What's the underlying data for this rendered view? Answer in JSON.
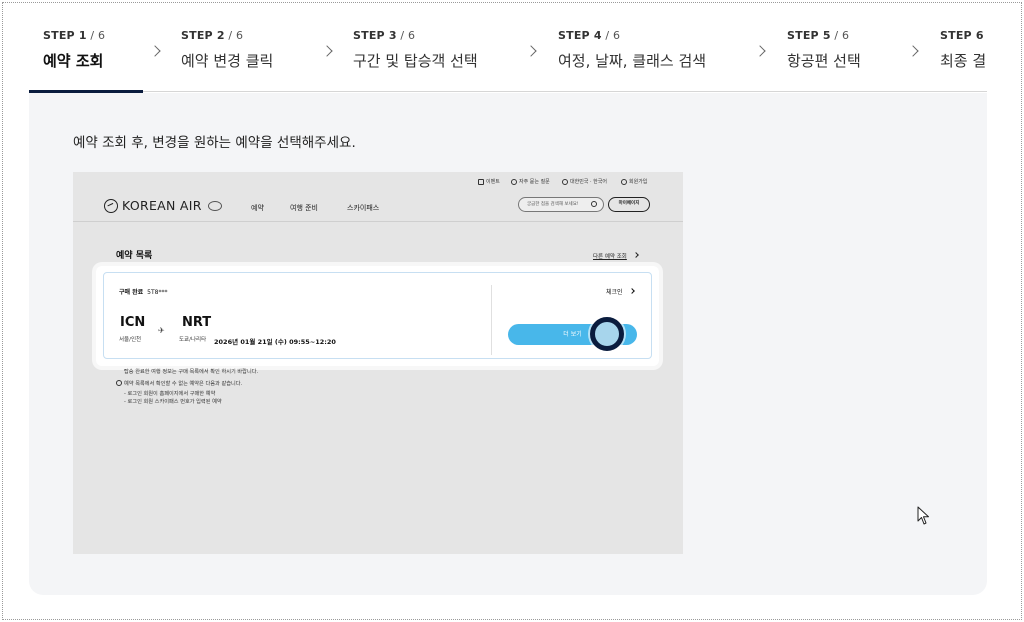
{
  "steps": [
    {
      "num": "STEP 1",
      "total": " / 6",
      "title": "예약 조회"
    },
    {
      "num": "STEP 2",
      "total": " / 6",
      "title": "예약 변경 클릭"
    },
    {
      "num": "STEP 3",
      "total": " / 6",
      "title": "구간 및 탑승객 선택"
    },
    {
      "num": "STEP 4",
      "total": " / 6",
      "title": "여정, 날짜, 클래스 검색"
    },
    {
      "num": "STEP 5",
      "total": " / 6",
      "title": "항공편 선택"
    },
    {
      "num": "STEP 6",
      "total": " / 6",
      "title": "최종 결"
    }
  ],
  "active_step": 1,
  "instruction": "예약 조회 후, 변경을 원하는 예약을 선택해주세요.",
  "screenshot": {
    "util_links": [
      "이벤트",
      "자주 묻는 질문",
      "대한민국 · 한국어",
      "회원가입"
    ],
    "logo_text": "KOREAN AIR",
    "gnb": [
      "예약",
      "여행 준비",
      "스카이패스"
    ],
    "search_placeholder": "궁금한 점을 검색해 보세요!",
    "mypage": "마이페이지",
    "list_title": "예약 목록",
    "other_link": "다른 예약 조회",
    "card": {
      "status_label": "구매 완료",
      "booking_ref": "5T8***",
      "checkin": "체크인",
      "origin_code": "ICN",
      "origin_city": "서울/인천",
      "dest_code": "NRT",
      "dest_city": "도쿄/나리타",
      "plane_glyph": "✈",
      "date": "2026년 01월 21일 (수) 09:55~12:20",
      "more_button": "더 보기"
    },
    "notes": [
      "탑승 완료한 여행 정보는 구매 목록에서 확인 하시기 바랍니다.",
      "예약 목록에서 확인할 수 없는 예약은 다음과 같습니다.",
      "- 로그인 회원이 홈페이지에서 구매한 예약",
      "- 로그인 회원 스카이패스 번호가 입력된 예약"
    ]
  },
  "colors": {
    "active_bar": "#0a1c3e",
    "more_button": "#48b7ea",
    "tap_ring": "#0a1c3e"
  }
}
